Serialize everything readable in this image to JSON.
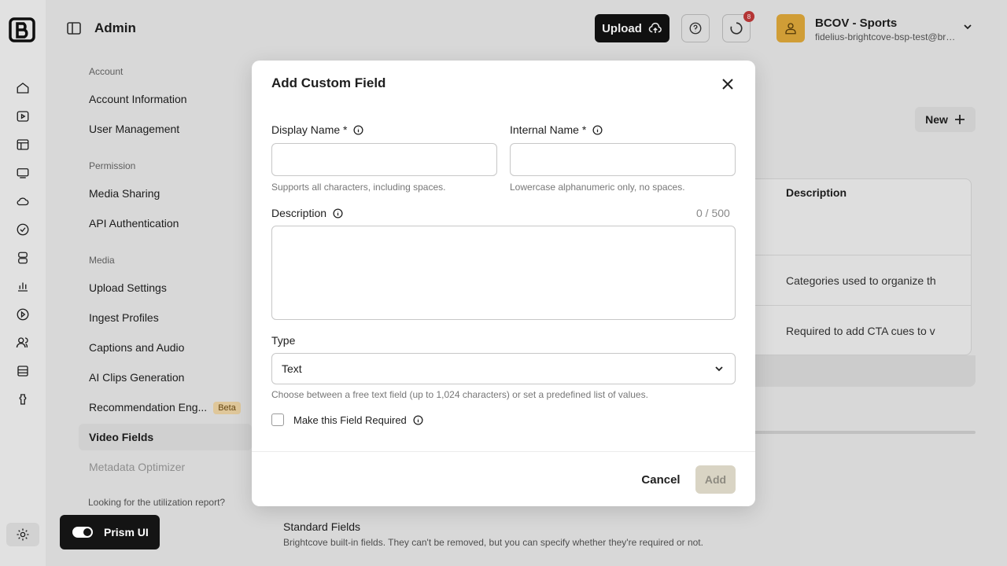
{
  "header": {
    "title": "Admin",
    "upload_label": "Upload",
    "notification_count": "8",
    "account_name": "BCOV - Sports",
    "account_email": "fidelius-brightcove-bsp-test@brightcove.com"
  },
  "nav": {
    "sections": [
      {
        "label": "Account",
        "items": [
          "Account Information",
          "User Management"
        ]
      },
      {
        "label": "Permission",
        "items": [
          "Media Sharing",
          "API Authentication"
        ]
      },
      {
        "label": "Media",
        "items": [
          "Upload Settings",
          "Ingest Profiles",
          "Captions and Audio",
          "AI Clips Generation",
          "Recommendation Eng...",
          "Video Fields",
          "Metadata Optimizer"
        ]
      }
    ],
    "beta_badge": "Beta",
    "active_item": "Video Fields",
    "utilization_text": "Looking for the utilization report?"
  },
  "main": {
    "new_label": "New",
    "table_header_description": "Description",
    "rows": [
      "Categories used to organize th",
      "Required to add CTA cues to v"
    ],
    "standard_title": "Standard Fields",
    "standard_subtitle": "Brightcove built-in fields. They can't be removed, but you can specify whether they're required or not."
  },
  "prism": {
    "label": "Prism UI",
    "enabled": true
  },
  "modal": {
    "title": "Add Custom Field",
    "display_name_label": "Display Name *",
    "display_name_value": "",
    "display_name_help": "Supports all characters, including spaces.",
    "internal_name_label": "Internal Name *",
    "internal_name_value": "",
    "internal_name_help": "Lowercase alphanumeric only, no spaces.",
    "description_label": "Description",
    "description_counter": "0 / 500",
    "type_label": "Type",
    "type_value": "Text",
    "type_help": "Choose between a free text field (up to 1,024 characters) or set a predefined list of values.",
    "required_label": "Make this Field Required",
    "required_checked": false,
    "cancel_label": "Cancel",
    "add_label": "Add"
  },
  "colors": {
    "primary_dark": "#121212",
    "avatar": "#e0a93b",
    "badge": "#c23a3a",
    "disabled_button": "#d9d4c4"
  }
}
